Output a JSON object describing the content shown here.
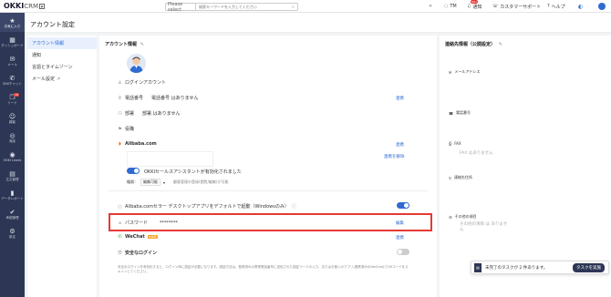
{
  "topbar": {
    "logo": "OKKI",
    "logo_suffix": "CRM",
    "logo_badge": "β",
    "search_select": "Please select",
    "search_placeholder": "検索キーワードを入力してください",
    "user_initials": "TM",
    "notifications_label": "通知",
    "notifications_count": "99+",
    "support_label": "カスタマーサポート",
    "help_label": "ヘルプ"
  },
  "sidebar": {
    "items": [
      {
        "icon": "home-icon",
        "glyph": "★",
        "label": "お気に入り"
      },
      {
        "icon": "dashboard-icon",
        "glyph": "▦",
        "label": "ダッシュボード"
      },
      {
        "icon": "mail-icon",
        "glyph": "✉",
        "label": "メール"
      },
      {
        "icon": "chat-icon",
        "glyph": "✆",
        "label": "SNSチャット"
      },
      {
        "icon": "lead-icon",
        "glyph": "❐",
        "label": "リード",
        "count": "18"
      },
      {
        "icon": "customer-icon",
        "glyph": "☺",
        "label": "顧客"
      },
      {
        "icon": "globe-icon",
        "glyph": "◎",
        "label": "商談"
      },
      {
        "icon": "okki-leads-icon",
        "glyph": "◉",
        "label": "OKKI Leads"
      },
      {
        "icon": "order-icon",
        "glyph": "▤",
        "label": "注文管理"
      },
      {
        "icon": "data-icon",
        "glyph": "▮",
        "label": "データレポート"
      },
      {
        "icon": "approval-icon",
        "glyph": "✔",
        "label": "承認管理"
      },
      {
        "icon": "settings-icon",
        "glyph": "⚙",
        "label": "設定"
      }
    ]
  },
  "page_title": "アカウント設定",
  "left_nav": {
    "items": [
      {
        "label": "アカウント情報"
      },
      {
        "label": "通知"
      },
      {
        "label": "言語とタイムゾーン"
      },
      {
        "label": "メール設定"
      }
    ]
  },
  "account": {
    "section_title": "アカウント情報",
    "login_account": "ログインアカウント",
    "phone_label": "電話番号",
    "phone_value": "電話番号 はありません",
    "phone_link": "連携",
    "dept_label": "部署",
    "dept_value": "部署 はありません",
    "title_label": "役職",
    "alibaba_label": "Alibaba.com",
    "alibaba_link": "連携",
    "unlink_label": "連携を解除",
    "assistant_label": "OKKIセールスアシスタントが有効化されました",
    "permission_label": "権限：",
    "permission_value": "編集可能",
    "permission_note": "顧客管理の登録(閲覧/編集)が可能",
    "desktop_label": "Alibaba.comセラー デスクトップアプリをデフォルトで起動（Windowsのみ）",
    "password_label": "パスワード",
    "password_value": "********",
    "password_link": "編集",
    "wechat_label": "WeChat",
    "wechat_tag": "未連携",
    "wechat_link": "連携",
    "secure_login_label": "安全なログイン",
    "secure_note": "安全なログインを有効化すると、ログイン時に認証が必要になります。認証方法は、登録済みの携帯電話番号に送信された認証コードの入力、またはお使いのアプリ(連携済みのWeChat)でQRコードをスキャンしてください。"
  },
  "contact": {
    "section_title": "連絡先情報（公開設定）",
    "email_label": "メールアドレス",
    "phone_label": "電話番号",
    "fax_label": "FAX",
    "fax_value": "FAX はありません",
    "address_label": "連絡先住所",
    "other_label": "その他の項目",
    "other_value": "その他の項目 は ありません"
  },
  "toast": {
    "text": "未完了のタスクが 2 件あります。",
    "button": "タスクを実施"
  }
}
